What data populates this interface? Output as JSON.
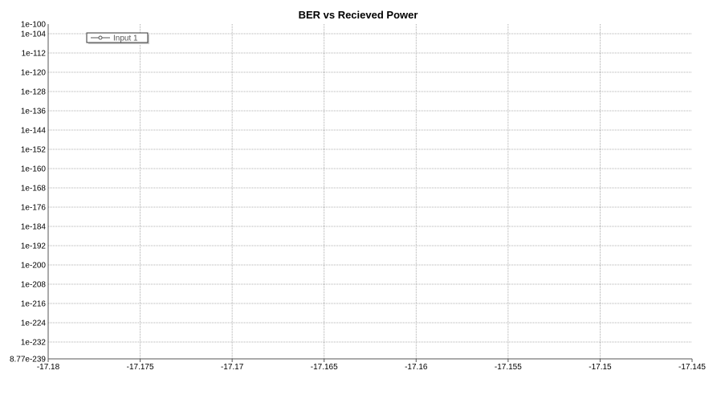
{
  "chart_data": {
    "type": "line",
    "title": "BER vs Recieved Power",
    "xlabel": "",
    "ylabel": "",
    "x_scale": "linear",
    "y_scale": "log",
    "xlim": [
      -17.18,
      -17.145
    ],
    "ylim_exponent": [
      -239,
      -100
    ],
    "x_ticks": [
      "-17.18",
      "-17.175",
      "-17.17",
      "-17.165",
      "-17.16",
      "-17.155",
      "-17.15",
      "-17.145"
    ],
    "x_tick_values": [
      -17.18,
      -17.175,
      -17.17,
      -17.165,
      -17.16,
      -17.155,
      -17.15,
      -17.145
    ],
    "y_ticks": [
      "1e-100",
      "1e-104",
      "1e-112",
      "1e-120",
      "1e-128",
      "1e-136",
      "1e-144",
      "1e-152",
      "1e-160",
      "1e-168",
      "1e-176",
      "1e-184",
      "1e-192",
      "1e-200",
      "1e-208",
      "1e-216",
      "1e-224",
      "1e-232",
      "8.77e-239"
    ],
    "y_tick_exponents": [
      -100,
      -104,
      -112,
      -120,
      -128,
      -136,
      -144,
      -152,
      -160,
      -168,
      -176,
      -184,
      -192,
      -200,
      -208,
      -216,
      -224,
      -232,
      -239
    ],
    "grid": true,
    "legend_position": "top-left",
    "series": [
      {
        "name": "Input 1",
        "x": [],
        "y": [],
        "color": "#555555",
        "marker": "circle"
      }
    ],
    "colors": {
      "grid": "#999999",
      "axis": "#555555",
      "background": "#ffffff"
    }
  }
}
